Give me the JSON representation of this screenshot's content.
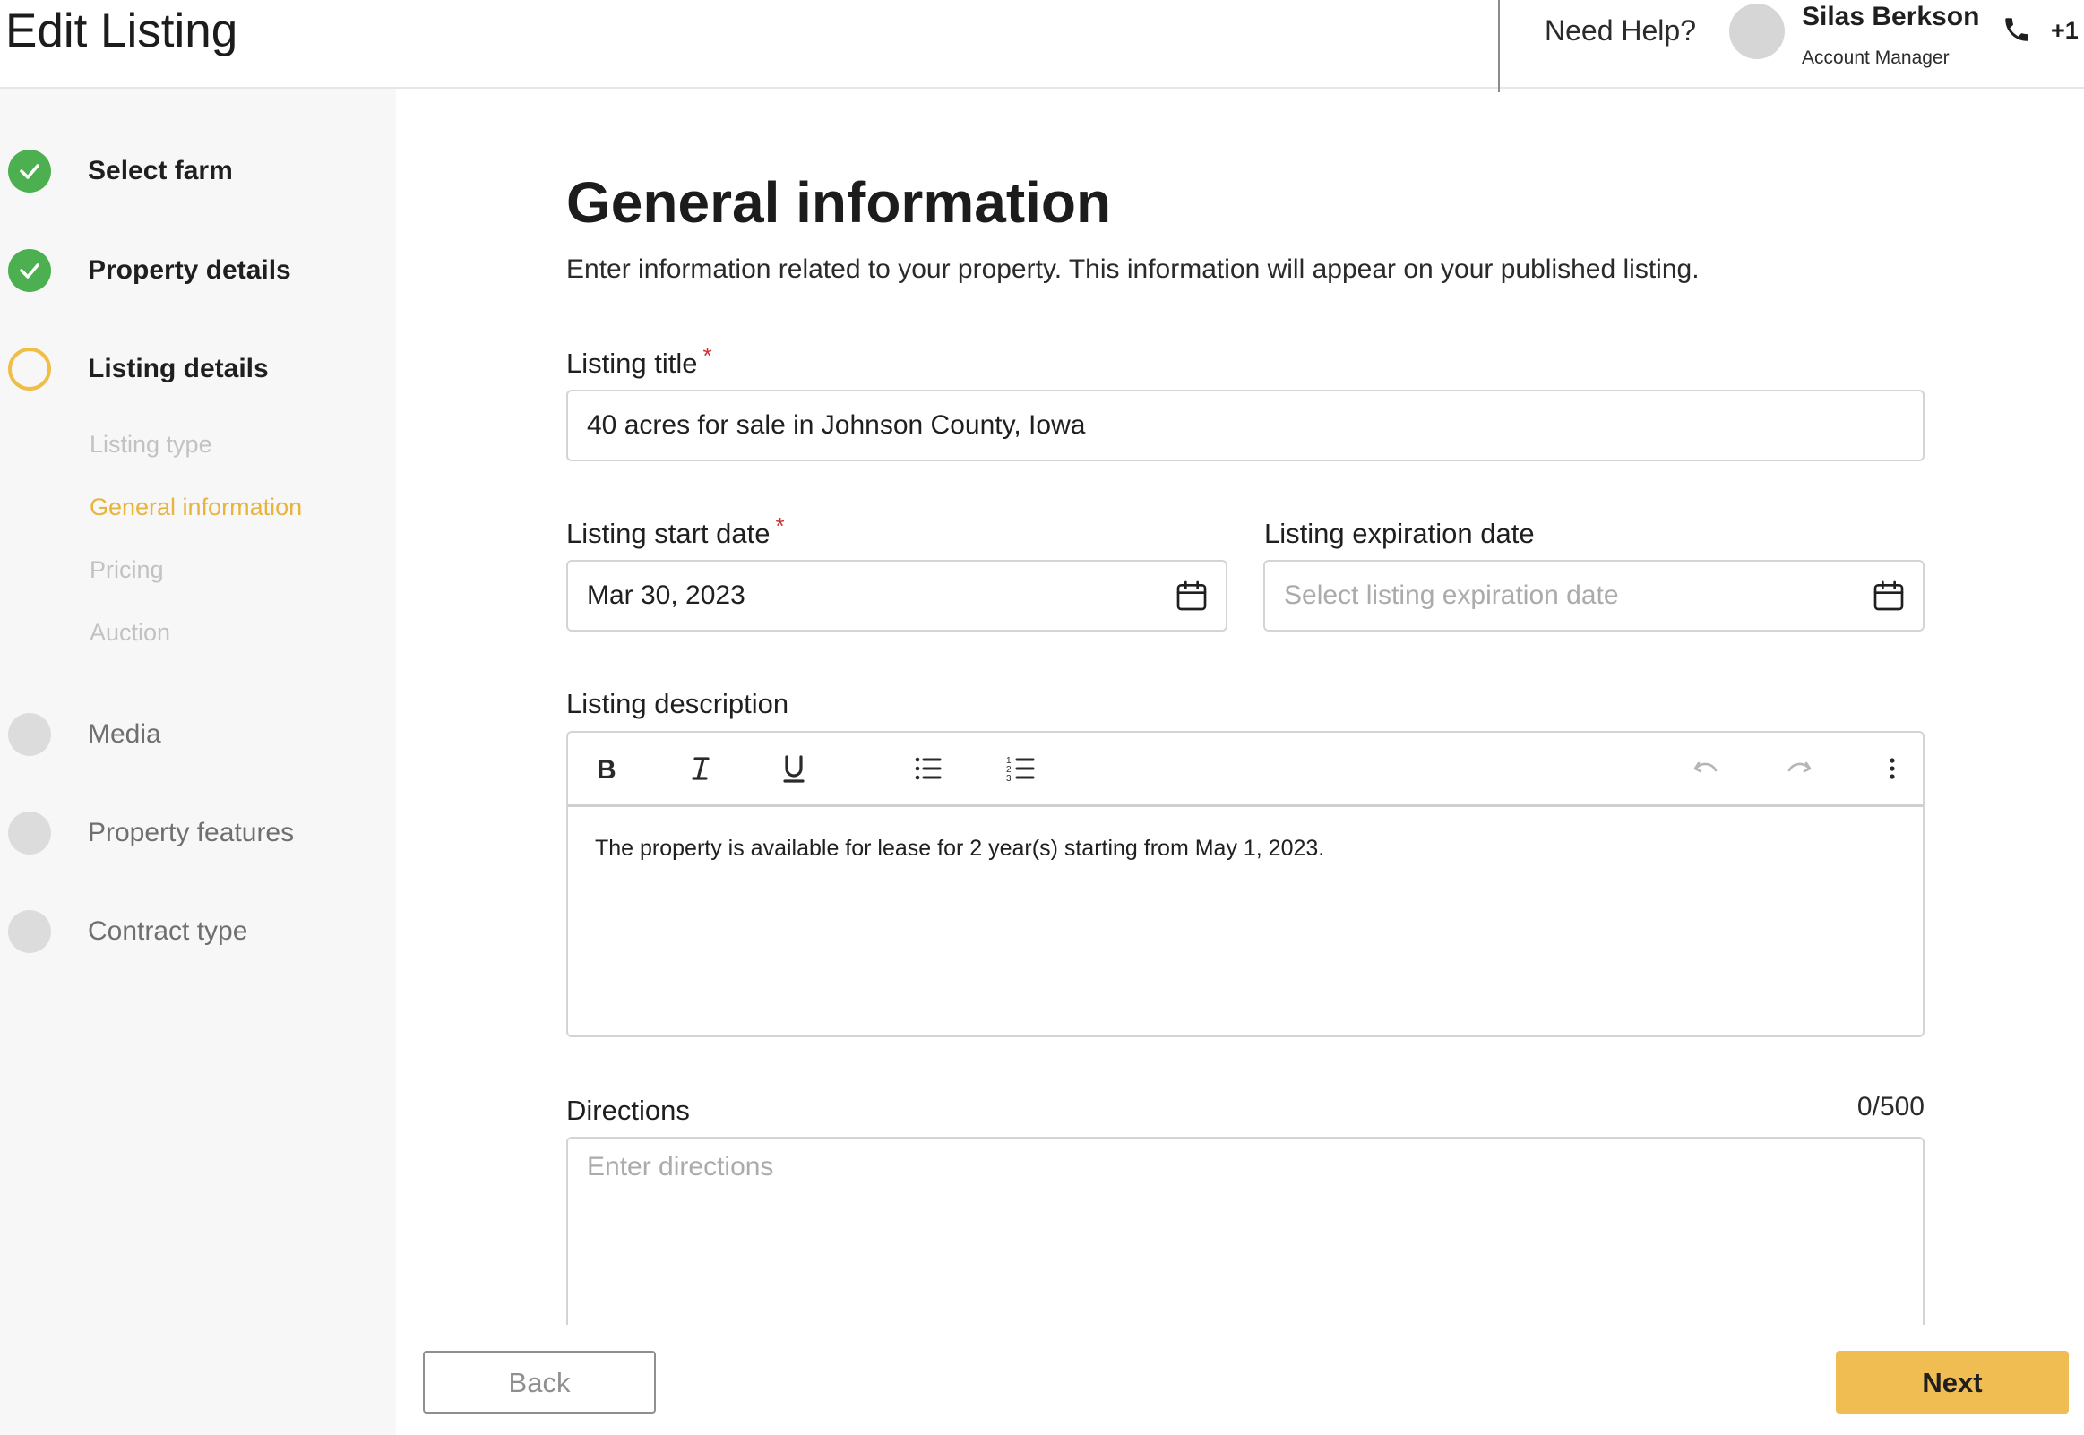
{
  "header": {
    "title": "Edit Listing",
    "need_help": "Need Help?",
    "manager_name": "Silas Berkson",
    "manager_role": "Account Manager",
    "phone": "+1"
  },
  "sidebar": {
    "steps": [
      {
        "label": "Select farm",
        "status": "done"
      },
      {
        "label": "Property details",
        "status": "done"
      },
      {
        "label": "Listing details",
        "status": "current"
      },
      {
        "label": "Media",
        "status": "todo"
      },
      {
        "label": "Property features",
        "status": "todo"
      },
      {
        "label": "Contract type",
        "status": "todo"
      }
    ],
    "substeps": [
      {
        "label": "Listing type",
        "active": false
      },
      {
        "label": "General information",
        "active": true
      },
      {
        "label": "Pricing",
        "active": false
      },
      {
        "label": "Auction",
        "active": false
      }
    ]
  },
  "main": {
    "title": "General information",
    "subtitle": "Enter information related to your property. This information will appear on your published listing.",
    "listing_title": {
      "label": "Listing title",
      "required": "*",
      "value": "40 acres for sale in Johnson County, Iowa"
    },
    "start_date": {
      "label": "Listing start date",
      "required": "*",
      "value": "Mar 30, 2023"
    },
    "expiration_date": {
      "label": "Listing expiration date",
      "placeholder": "Select listing expiration date"
    },
    "description": {
      "label": "Listing description",
      "body": "The property is available for lease for 2 year(s) starting from May 1, 2023.",
      "toolbar": [
        "bold-icon",
        "italic-icon",
        "underline-icon",
        "bulleted-list-icon",
        "numbered-list-icon",
        "undo-icon",
        "redo-icon",
        "more-options-icon"
      ]
    },
    "directions": {
      "label": "Directions",
      "counter": "0/500",
      "placeholder": "Enter directions"
    }
  },
  "footer": {
    "back_label": "Back",
    "next_label": "Next"
  },
  "colors": {
    "accent": "#f0bd52",
    "done": "#4caf50",
    "required": "#d32f2f",
    "active_substep": "#e9b43c"
  }
}
